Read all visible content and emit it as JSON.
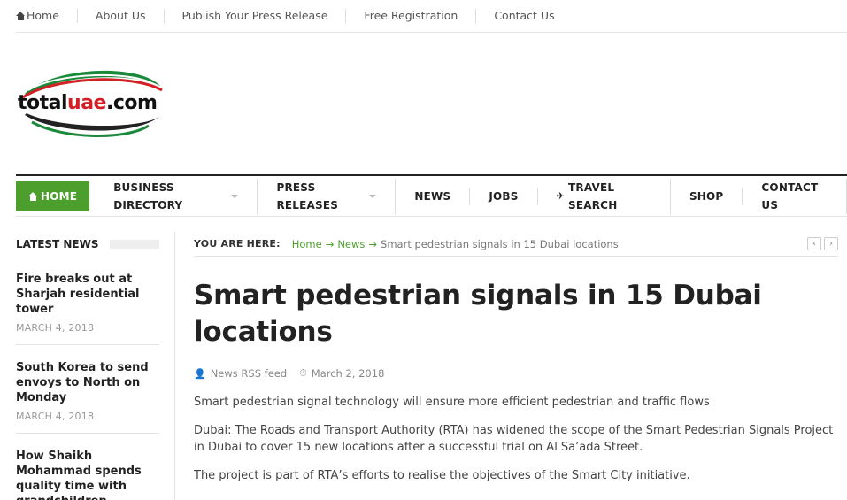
{
  "topbar": {
    "items": [
      "Home",
      "About Us",
      "Publish Your Press Release",
      "Free Registration",
      "Contact Us"
    ]
  },
  "logo": {
    "text_a": "total",
    "text_b": "uae",
    "text_c": ".com"
  },
  "mainnav": {
    "home": "HOME",
    "items": [
      "BUSINESS DIRECTORY",
      "PRESS RELEASES",
      "NEWS",
      "JOBS",
      "TRAVEL SEARCH",
      "SHOP",
      "CONTACT US"
    ]
  },
  "sidebar": {
    "heading": "LATEST NEWS",
    "items": [
      {
        "title": "Fire breaks out at Sharjah residential tower",
        "date": "MARCH 4, 2018"
      },
      {
        "title": "South Korea to send envoys to North on Monday",
        "date": "MARCH 4, 2018"
      },
      {
        "title": "How Shaikh Mohammad spends quality time with grandchildren",
        "date": ""
      }
    ]
  },
  "breadcrumb": {
    "label": "YOU ARE HERE:",
    "home": "Home",
    "section": "News",
    "current": "Smart pedestrian signals in 15 Dubai locations"
  },
  "article": {
    "title": "Smart pedestrian signals in 15 Dubai locations",
    "author": "News RSS feed",
    "date": "March 2, 2018",
    "paragraphs": [
      "Smart pedestrian signal technology will ensure more efficient pedestrian and traffic flows",
      "Dubai: The Roads and Transport Authority (RTA) has widened the scope of the Smart Pedestrian Signals Project in Dubai to cover 15 new locations after a successful trial on Al Sa’ada Street.",
      "The project is part of RTA’s efforts to realise the objectives of the Smart City initiative."
    ]
  },
  "colors": {
    "accent": "#4c9f2d",
    "logo_red": "#d32027",
    "logo_green": "#1a8a3a"
  }
}
